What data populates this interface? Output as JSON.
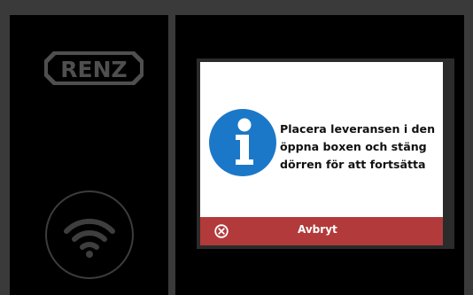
{
  "logo": {
    "text": "RENZ"
  },
  "wifi": {
    "icon": "wifi-icon"
  },
  "dialog": {
    "icon": "info-icon",
    "message_lines": [
      "Placera leveransen i den",
      "öppna boxen och stäng",
      "dörren för att fortsätta"
    ],
    "cancel": {
      "icon": "cancel-circle-icon",
      "label": "Avbryt"
    }
  },
  "colors": {
    "background": "#3a3a3a",
    "panel": "#000000",
    "accent_blue": "#1b78c8",
    "cancel_red": "#b23a3a",
    "logo_gray": "#4f4f4f"
  }
}
